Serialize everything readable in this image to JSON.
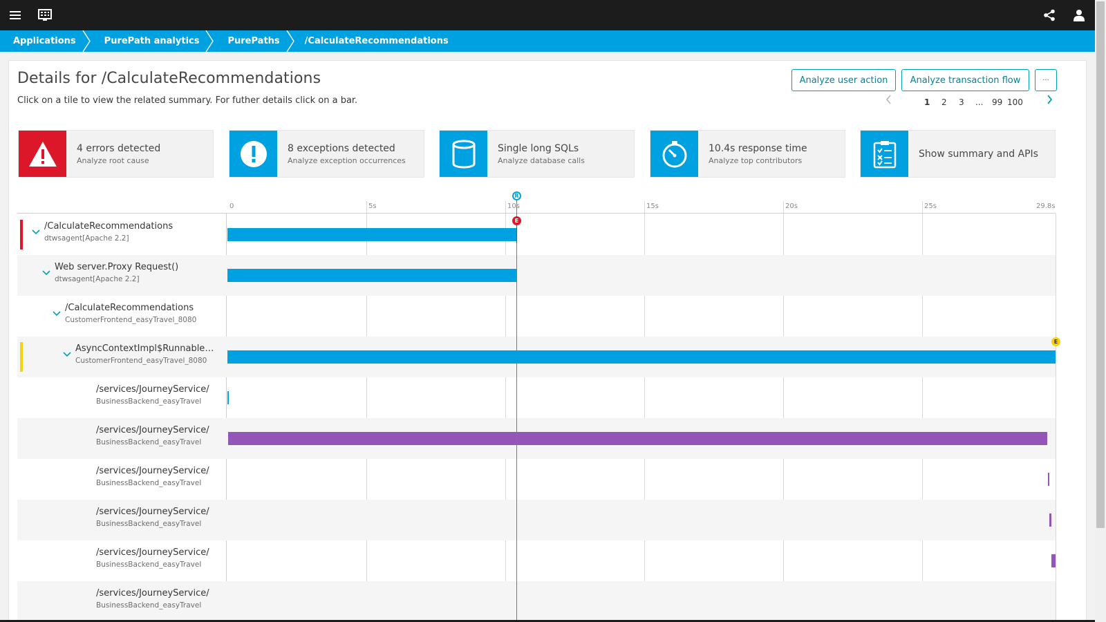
{
  "topbar": {
    "menu_icon": "hamburger-menu-icon",
    "dashboard_icon": "dashboard-icon",
    "share_icon": "share-icon",
    "user_icon": "user-icon"
  },
  "breadcrumb": [
    "Applications",
    "PurePath analytics",
    "PurePaths",
    "/CalculateRecommendations"
  ],
  "header": {
    "title": "Details for /CalculateRecommendations",
    "subtitle": "Click on a tile to view the related summary. For futher details click on a bar.",
    "analyze_user_action": "Analyze user action",
    "analyze_transaction_flow": "Analyze transaction flow",
    "more": "···"
  },
  "pager": {
    "pages": [
      "1",
      "2",
      "3",
      "...",
      "99",
      "100"
    ],
    "active": "1"
  },
  "tiles": [
    {
      "title": "4 errors detected",
      "subtitle": "Analyze root cause",
      "icon": "warning-triangle-icon",
      "color": "#dc172a"
    },
    {
      "title": "8 exceptions detected",
      "subtitle": "Analyze exception occurrences",
      "icon": "exclamation-circle-icon",
      "color": "#00a1e0"
    },
    {
      "title": "Single long SQLs",
      "subtitle": "Analyze database calls",
      "icon": "database-icon",
      "color": "#00a1e0"
    },
    {
      "title": "10.4s response time",
      "subtitle": "Analyze top contributors",
      "icon": "stopwatch-icon",
      "color": "#00a1e0"
    },
    {
      "title": "Show summary and APIs",
      "subtitle": "",
      "icon": "clipboard-checklist-icon",
      "color": "#00a1e0"
    }
  ],
  "timeline": {
    "ticks": [
      "0",
      "5s",
      "10s",
      "15s",
      "20s",
      "25s",
      "29.8s"
    ],
    "tick_values": [
      0,
      5,
      10,
      15,
      20,
      25,
      29.8
    ],
    "total_s": 29.8,
    "response_marker_s": 10.4,
    "response_badge": "R",
    "error_badge": "E"
  },
  "rows": [
    {
      "name": "/CalculateRecommendations",
      "agent": "dtwsagent[Apache 2.2]",
      "level": 0,
      "expandable": true,
      "marker": "#dc172a",
      "bar_start_s": 0,
      "bar_end_s": 10.4,
      "bar_color": "#00a1e0"
    },
    {
      "name": "Web server.Proxy Request()",
      "agent": "dtwsagent[Apache 2.2]",
      "level": 1,
      "expandable": true,
      "marker": "",
      "bar_start_s": 0,
      "bar_end_s": 10.4,
      "bar_color": "#00a1e0"
    },
    {
      "name": "/CalculateRecommendations",
      "agent": "CustomerFrontend_easyTravel_8080",
      "level": 2,
      "expandable": true,
      "marker": "",
      "bar_start_s": null,
      "bar_end_s": null,
      "bar_color": ""
    },
    {
      "name": "AsyncContextImpl$RunnableWra...",
      "agent": "CustomerFrontend_easyTravel_8080",
      "level": 3,
      "expandable": true,
      "marker": "#f5d30f",
      "bar_start_s": 0,
      "bar_end_s": 29.8,
      "bar_color": "#00a1e0"
    },
    {
      "name": "/services/JourneyService/",
      "agent": "BusinessBackend_easyTravel",
      "level": 4,
      "expandable": false,
      "marker": "",
      "bar_start_s": 0,
      "bar_end_s": 0.05,
      "bar_color": "#00a1e0"
    },
    {
      "name": "/services/JourneyService/",
      "agent": "BusinessBackend_easyTravel",
      "level": 4,
      "expandable": false,
      "marker": "",
      "bar_start_s": 0.02,
      "bar_end_s": 29.5,
      "bar_color": "#9355b7"
    },
    {
      "name": "/services/JourneyService/",
      "agent": "BusinessBackend_easyTravel",
      "level": 4,
      "expandable": false,
      "marker": "",
      "bar_start_s": 29.52,
      "bar_end_s": 29.55,
      "bar_color": "#9355b7"
    },
    {
      "name": "/services/JourneyService/",
      "agent": "BusinessBackend_easyTravel",
      "level": 4,
      "expandable": false,
      "marker": "",
      "bar_start_s": 29.58,
      "bar_end_s": 29.65,
      "bar_color": "#9355b7"
    },
    {
      "name": "/services/JourneyService/",
      "agent": "BusinessBackend_easyTravel",
      "level": 4,
      "expandable": false,
      "marker": "",
      "bar_start_s": 29.65,
      "bar_end_s": 29.8,
      "bar_color": "#9355b7"
    },
    {
      "name": "/services/JourneyService/",
      "agent": "BusinessBackend_easyTravel",
      "level": 4,
      "expandable": false,
      "marker": "",
      "bar_start_s": null,
      "bar_end_s": null,
      "bar_color": ""
    }
  ],
  "colors": {
    "accent": "#00a1e0",
    "error": "#dc172a",
    "warning": "#f5d30f",
    "purple": "#9355b7"
  }
}
